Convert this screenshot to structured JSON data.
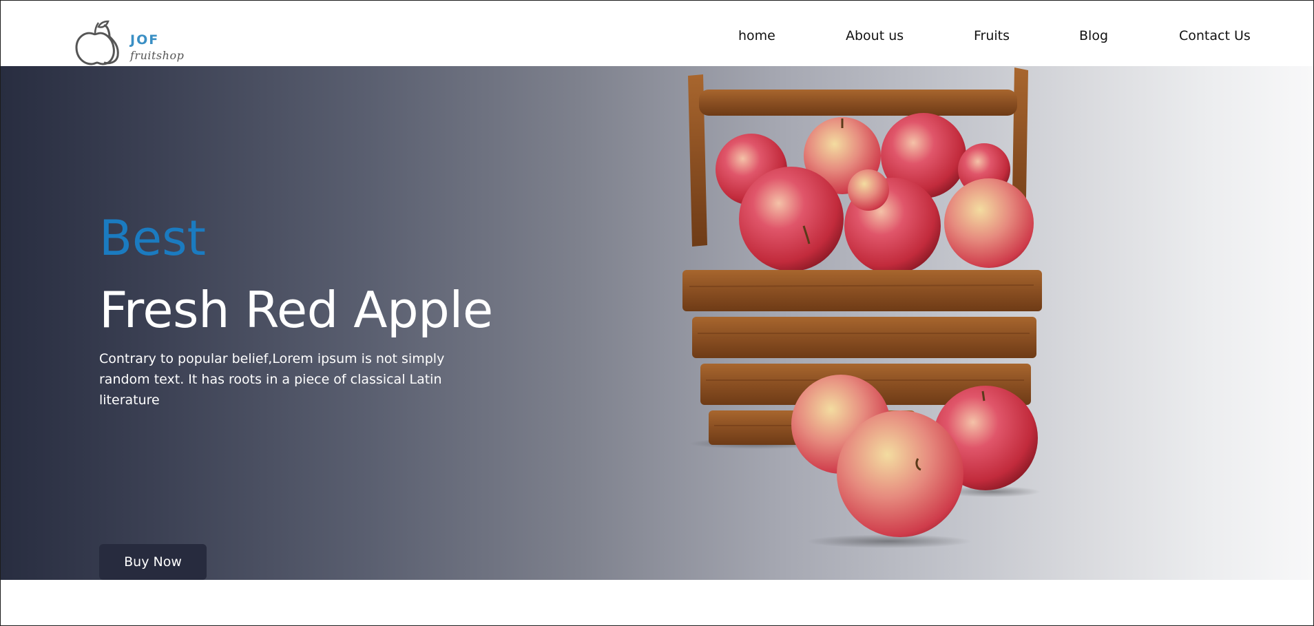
{
  "brand": {
    "name": "JOF",
    "tagline": "fruitshop"
  },
  "nav": {
    "items": [
      "home",
      "About us",
      "Fruits",
      "Blog",
      "Contact Us"
    ]
  },
  "hero": {
    "kicker": "Best",
    "title": "Fresh Red Apple",
    "description": "Contrary to popular belief,Lorem ipsum is not simply random text. It has roots in a piece of classical Latin literature",
    "cta_label": "Buy Now",
    "image": "apple-basket-image"
  },
  "colors": {
    "accent": "#1b7bc0",
    "button_bg": "#272b3e",
    "hero_gradient_start": "#282d40",
    "hero_gradient_end": "#f8f8f9",
    "logo_blue": "#3a8fc4"
  },
  "icons": {
    "logo": "apple-pear-logo-icon"
  }
}
